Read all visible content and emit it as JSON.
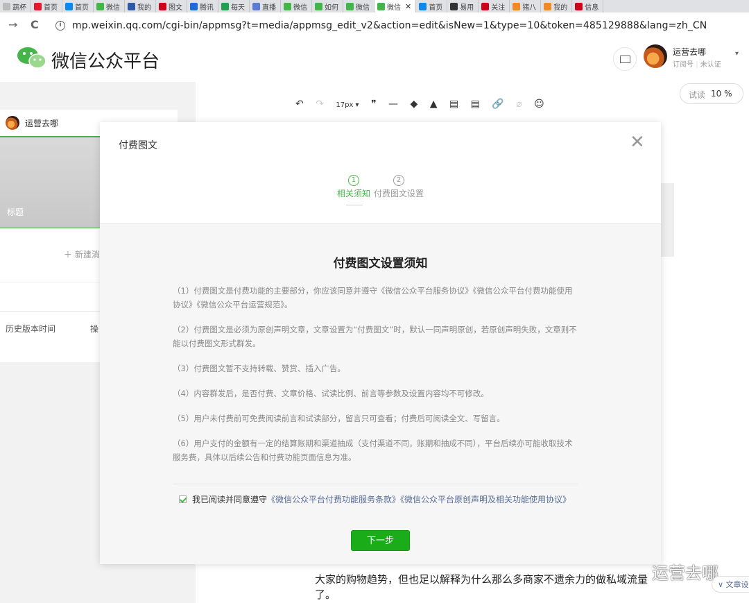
{
  "browser": {
    "tabs": [
      {
        "label": "蔬杯",
        "icon": "generic"
      },
      {
        "label": "首页",
        "icon": "weibo"
      },
      {
        "label": "首页",
        "icon": "zhihu"
      },
      {
        "label": "微信",
        "icon": "wechat"
      },
      {
        "label": "我的",
        "icon": "app"
      },
      {
        "label": "图文",
        "icon": "red"
      },
      {
        "label": "腾讯",
        "icon": "blue"
      },
      {
        "label": "每天",
        "icon": "table"
      },
      {
        "label": "直播",
        "icon": "play"
      },
      {
        "label": "微信",
        "icon": "wechat"
      },
      {
        "label": "如何",
        "icon": "wechat"
      },
      {
        "label": "微信",
        "icon": "wechat"
      },
      {
        "label": "微信",
        "icon": "wechat",
        "active": true,
        "close": "✕"
      },
      {
        "label": "首页",
        "icon": "zhihu"
      },
      {
        "label": "易用",
        "icon": "dark"
      },
      {
        "label": "关注",
        "icon": "red"
      },
      {
        "label": "猪八",
        "icon": "orange"
      },
      {
        "label": "我的",
        "icon": "orange"
      },
      {
        "label": "信息",
        "icon": "red"
      }
    ],
    "url": "mp.weixin.qq.com/cgi-bin/appmsg?t=media/appmsg_edit_v2&action=edit&isNew=1&type=10&token=485129888&lang=zh_CN",
    "back_glyph": "→",
    "reload_glyph": "C",
    "info_glyph": "i"
  },
  "header": {
    "brand": "微信公众平台",
    "account_name": "运营去哪",
    "account_type": "订阅号",
    "account_status": "未认证",
    "arrow_glyph": "▾"
  },
  "editor": {
    "toolbar": {
      "undo": "↶",
      "redo": "↷",
      "font_size": "17px ▾",
      "quote": "❞",
      "hr": "—",
      "paint": "◆",
      "clear": "▲",
      "tpl1": "▤",
      "tpl2": "▤",
      "link": "🔗",
      "unlink": "⌀",
      "emoji": "☺"
    },
    "read_trial_label": "试读",
    "read_trial_value": "10 %",
    "left_panel": {
      "account": "运营去哪",
      "cover_title": "标题",
      "new_article": "＋  新建消",
      "history_time": "历史版本时间",
      "history_op": "操"
    },
    "article_lines": [
      "大家的购物趋势，但也足以解释为什么那么多商家不遗余力的做私域流量",
      "了。"
    ],
    "watermark": "运营去哪",
    "bottom_tab": "∨ 文章设"
  },
  "dialog": {
    "title": "付费图文",
    "close": "✕",
    "steps": [
      {
        "num": "1",
        "label": "相关须知",
        "active": true
      },
      {
        "num": "2",
        "label": "付费图文设置",
        "active": false
      }
    ],
    "notice_title": "付费图文设置须知",
    "notices": [
      "（1）付费图文是付费功能的主要部分，你应该同意并遵守《微信公众平台服务协议》《微信公众平台付费功能使用协议》《微信公众平台运营规范》。",
      "（2）付费图文是必须为原创声明文章，文章设置为“付费图文”时，默认一同声明原创，若原创声明失败，文章则不能以付费图文形式群发。",
      "（3）付费图文暂不支持转载、赞赏、插入广告。",
      "（4）内容群发后，是否付费、文章价格、试读比例、前言等参数及设置内容均不可修改。",
      "（5）用户未付费前可免费阅读前言和试读部分，留言只可查看；付费后可阅读全文、写留言。",
      "（6）用户支付的金额有一定的结算账期和渠道抽成（支付渠道不同，账期和抽成不同），平台后续亦可能收取技术服务费，具体以后续公告和付费功能页面信息为准。"
    ],
    "agree_prefix": "我已阅读并同意遵守",
    "agree_link1": "《微信公众平台付费功能服务条款》",
    "agree_link2": "《微信公众平台原创声明及相关功能使用协议》",
    "agree_checked": true,
    "next_button": "下一步"
  },
  "colors": {
    "accent_green": "#44b549",
    "button_green": "#1aad19",
    "link_blue": "#576b95"
  }
}
